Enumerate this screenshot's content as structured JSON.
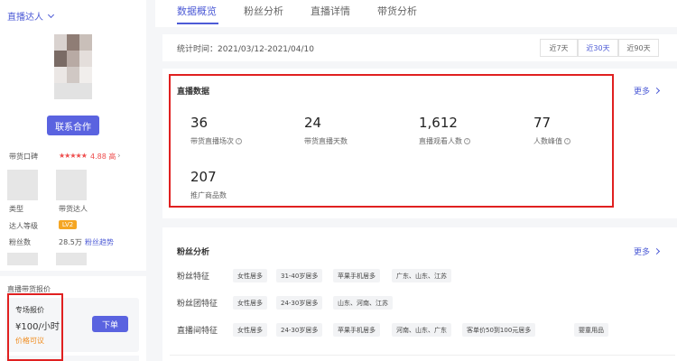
{
  "sidebar": {
    "role_label": "直播达人",
    "contact_button": "联系合作",
    "reputation_label": "带货口碑",
    "rating": "4.88 高",
    "type_label": "类型",
    "type_value": "带货达人",
    "level_label": "达人等级",
    "level_value": "LV2",
    "fans_label": "粉丝数",
    "fans_value": "28.5万",
    "fans_trend_link": "粉丝趋势",
    "price_section_title": "直播带货报价",
    "price_label": "专场报价",
    "price_value": "¥100/小时",
    "price_negotiable": "价格可议",
    "order_button": "下单"
  },
  "tabs": [
    {
      "label": "数据概览",
      "active": true
    },
    {
      "label": "粉丝分析",
      "active": false
    },
    {
      "label": "直播详情",
      "active": false
    },
    {
      "label": "带货分析",
      "active": false
    }
  ],
  "stats_bar": {
    "time_text": "统计时间：2021/03/12-2021/04/10",
    "ranges": [
      {
        "label": "近7天",
        "active": false
      },
      {
        "label": "近30天",
        "active": true
      },
      {
        "label": "近90天",
        "active": false
      }
    ]
  },
  "live_data": {
    "title": "直播数据",
    "more": "更多",
    "metrics": [
      {
        "value": "36",
        "label": "带货直播场次",
        "info": true
      },
      {
        "value": "24",
        "label": "带货直播天数",
        "info": false
      },
      {
        "value": "1,612",
        "label": "直播观看人数",
        "info": true
      },
      {
        "value": "77",
        "label": "人数峰值",
        "info": true
      },
      {
        "value": "207",
        "label": "推广商品数",
        "info": false
      }
    ]
  },
  "fan_analysis": {
    "title": "粉丝分析",
    "more": "更多",
    "rows": [
      {
        "label": "粉丝特征",
        "tags": [
          "女性居多",
          "31-40岁居多",
          "苹果手机居多",
          "广东、山东、江苏"
        ]
      },
      {
        "label": "粉丝团特征",
        "tags": [
          "女性居多",
          "24-30岁居多",
          "山东、河南、江苏"
        ]
      },
      {
        "label": "直播间特征",
        "tags": [
          "女性居多",
          "24-30岁居多",
          "苹果手机居多",
          "河南、山东、广东",
          "客单价50到100元居多",
          "婴童用品"
        ]
      }
    ]
  },
  "colors": {
    "accent": "#4d5bd6",
    "button": "#5a63e0",
    "highlight_border": "#e02020",
    "negotiable": "#f08c1e",
    "rating": "#ee4d4d"
  }
}
